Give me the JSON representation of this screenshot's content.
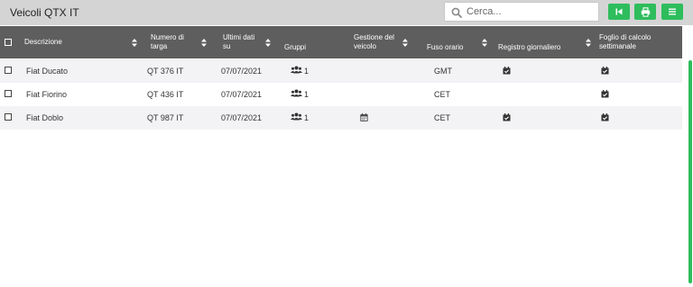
{
  "header": {
    "title": "Veicoli QTX IT",
    "search_placeholder": "Cerca..."
  },
  "toolbar": {
    "buttons": [
      {
        "name": "first-page-button",
        "icon": "skip-back-icon"
      },
      {
        "name": "print-button",
        "icon": "printer-icon"
      },
      {
        "name": "menu-button",
        "icon": "menu-icon"
      }
    ],
    "accent": "#2ebd5c"
  },
  "table": {
    "columns": [
      {
        "key": "descrizione",
        "line1": "Descrizione",
        "line2": ""
      },
      {
        "key": "targa",
        "line1": "Numero di",
        "line2": "targa"
      },
      {
        "key": "ultimi",
        "line1": "Ultimi dati",
        "line2": "su"
      },
      {
        "key": "gruppi",
        "line1": "Gruppi",
        "line2": ""
      },
      {
        "key": "gestione",
        "line1": "Gestione del",
        "line2": "veicolo"
      },
      {
        "key": "fuso",
        "line1": "Fuso orario",
        "line2": ""
      },
      {
        "key": "registro",
        "line1": "Registro giornaliero",
        "line2": ""
      },
      {
        "key": "foglio",
        "line1": "Foglio di calcolo",
        "line2": "settimanale"
      }
    ],
    "rows": [
      {
        "descrizione": "Fiat Ducato",
        "targa": "QT 376 IT",
        "ultimi": "07/07/2021",
        "gruppi": "1",
        "gestione": false,
        "fuso": "GMT",
        "registro": true,
        "foglio": true
      },
      {
        "descrizione": "Fiat Fiorino",
        "targa": "QT 436 IT",
        "ultimi": "07/07/2021",
        "gruppi": "1",
        "gestione": false,
        "fuso": "CET",
        "registro": false,
        "foglio": true
      },
      {
        "descrizione": "Fiat Doblo",
        "targa": "QT 987 IT",
        "ultimi": "07/07/2021",
        "gruppi": "1",
        "gestione": true,
        "fuso": "CET",
        "registro": true,
        "foglio": true
      }
    ]
  },
  "colors": {
    "header_bg": "#d4d4d4",
    "table_header_bg": "#5e5e5e",
    "alt_row_bg": "#f3f3f6"
  }
}
